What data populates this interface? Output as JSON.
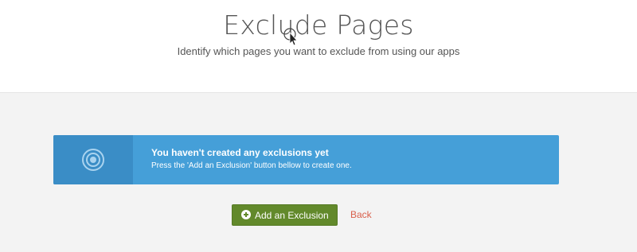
{
  "header": {
    "title": "Exclude Pages",
    "subtitle": "Identify which pages you want to exclude from using our apps"
  },
  "notice": {
    "icon": "target-icon",
    "title": "You haven't created any exclusions yet",
    "text": "Press the 'Add an Exclusion' button bellow to create one."
  },
  "actions": {
    "add_label": "Add an Exclusion",
    "add_icon": "plus-circle-icon",
    "back_label": "Back"
  },
  "colors": {
    "notice_bg": "#459fd8",
    "notice_icon_bg": "#3a8dc6",
    "add_button": "#62892b",
    "back_link": "#d9604c"
  }
}
